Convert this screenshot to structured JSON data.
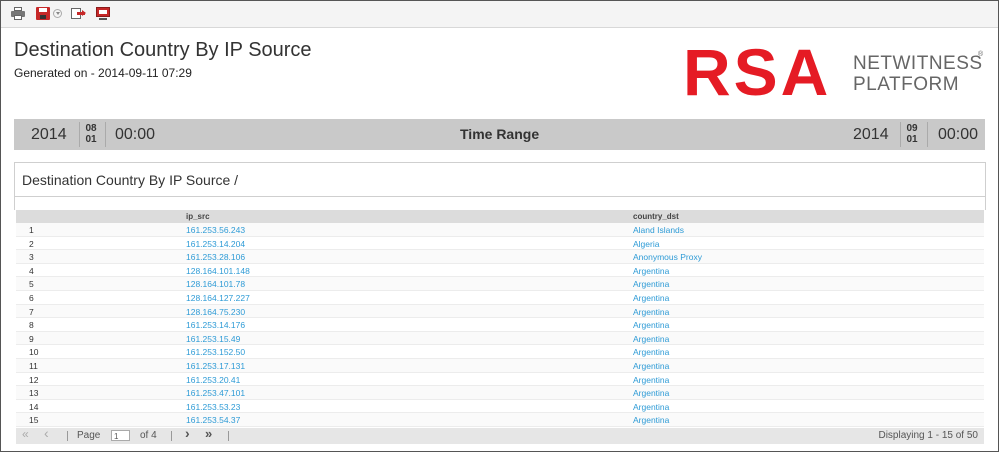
{
  "toolbar": {
    "icons": [
      "printer-icon",
      "save-icon",
      "dropdown-icon",
      "export-icon",
      "window-icon"
    ]
  },
  "header": {
    "title": "Destination Country By IP Source",
    "generated": "Generated on - 2014-09-11 07:29"
  },
  "logo": {
    "brand": "RSA",
    "line1": "NETWITNESS",
    "line2": "PLATFORM",
    "reg": "®"
  },
  "time_range": {
    "label": "Time Range",
    "start": {
      "year": "2014",
      "month": "08",
      "day": "01",
      "time": "00:00"
    },
    "end": {
      "year": "2014",
      "month": "09",
      "day": "01",
      "time": "00:00"
    }
  },
  "panel": {
    "title": "Destination Country By IP Source /"
  },
  "table": {
    "columns": [
      "ip_src",
      "country_dst"
    ],
    "rows": [
      {
        "n": "1",
        "ip": "161.253.56.243",
        "country": "Aland Islands"
      },
      {
        "n": "2",
        "ip": "161.253.14.204",
        "country": "Algeria"
      },
      {
        "n": "3",
        "ip": "161.253.28.106",
        "country": "Anonymous Proxy"
      },
      {
        "n": "4",
        "ip": "128.164.101.148",
        "country": "Argentina"
      },
      {
        "n": "5",
        "ip": "128.164.101.78",
        "country": "Argentina"
      },
      {
        "n": "6",
        "ip": "128.164.127.227",
        "country": "Argentina"
      },
      {
        "n": "7",
        "ip": "128.164.75.230",
        "country": "Argentina"
      },
      {
        "n": "8",
        "ip": "161.253.14.176",
        "country": "Argentina"
      },
      {
        "n": "9",
        "ip": "161.253.15.49",
        "country": "Argentina"
      },
      {
        "n": "10",
        "ip": "161.253.152.50",
        "country": "Argentina"
      },
      {
        "n": "11",
        "ip": "161.253.17.131",
        "country": "Argentina"
      },
      {
        "n": "12",
        "ip": "161.253.20.41",
        "country": "Argentina"
      },
      {
        "n": "13",
        "ip": "161.253.47.101",
        "country": "Argentina"
      },
      {
        "n": "14",
        "ip": "161.253.53.23",
        "country": "Argentina"
      },
      {
        "n": "15",
        "ip": "161.253.54.37",
        "country": "Argentina"
      }
    ]
  },
  "pager": {
    "first": "«",
    "prev": "‹",
    "page_label": "Page",
    "page_value": "1",
    "of_label": "of 4",
    "next": "›",
    "last": "»",
    "display": "Displaying 1 - 15 of 50"
  },
  "colors": {
    "brand_red": "#e51b24",
    "link_blue": "#2e9bd6",
    "bar_grey": "#c9c9c9"
  }
}
